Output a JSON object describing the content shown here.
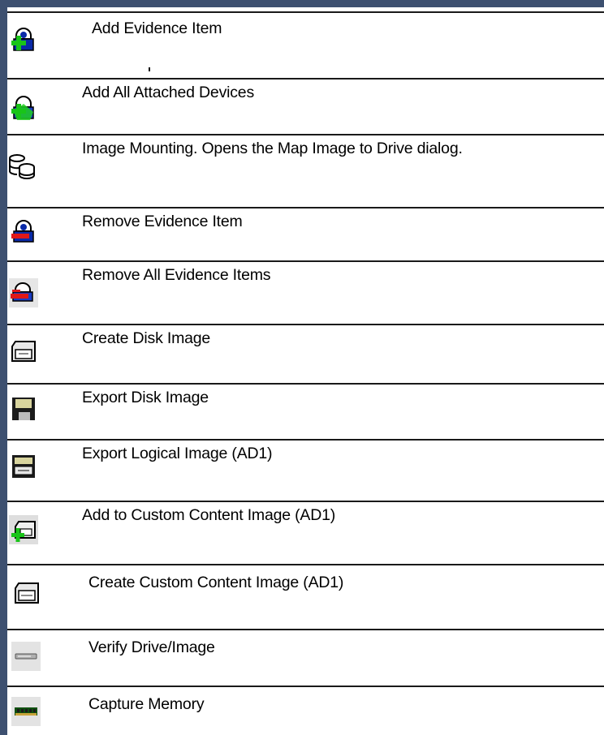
{
  "toolbar_legend": {
    "items": [
      {
        "icon": "add-evidence-icon",
        "label": "Add Evidence Item"
      },
      {
        "icon": "add-all-devices-icon",
        "label": "Add All Attached Devices"
      },
      {
        "icon": "image-mounting-icon",
        "label": "Image Mounting. Opens the Map Image to Drive dialog."
      },
      {
        "icon": "remove-evidence-icon",
        "label": "Remove Evidence Item"
      },
      {
        "icon": "remove-all-evidence-icon",
        "label": "Remove All Evidence Items"
      },
      {
        "icon": "create-disk-image-icon",
        "label": "Create Disk Image"
      },
      {
        "icon": "export-disk-image-icon",
        "label": "Export Disk Image"
      },
      {
        "icon": "export-logical-image-icon",
        "label": "Export Logical Image (AD1)"
      },
      {
        "icon": "add-custom-content-icon",
        "label": "Add to Custom Content Image (AD1)"
      },
      {
        "icon": "create-custom-content-icon",
        "label": "Create Custom Content Image (AD1)"
      },
      {
        "icon": "verify-drive-icon",
        "label": "Verify Drive/Image"
      },
      {
        "icon": "capture-memory-icon",
        "label": "Capture Memory"
      }
    ]
  }
}
